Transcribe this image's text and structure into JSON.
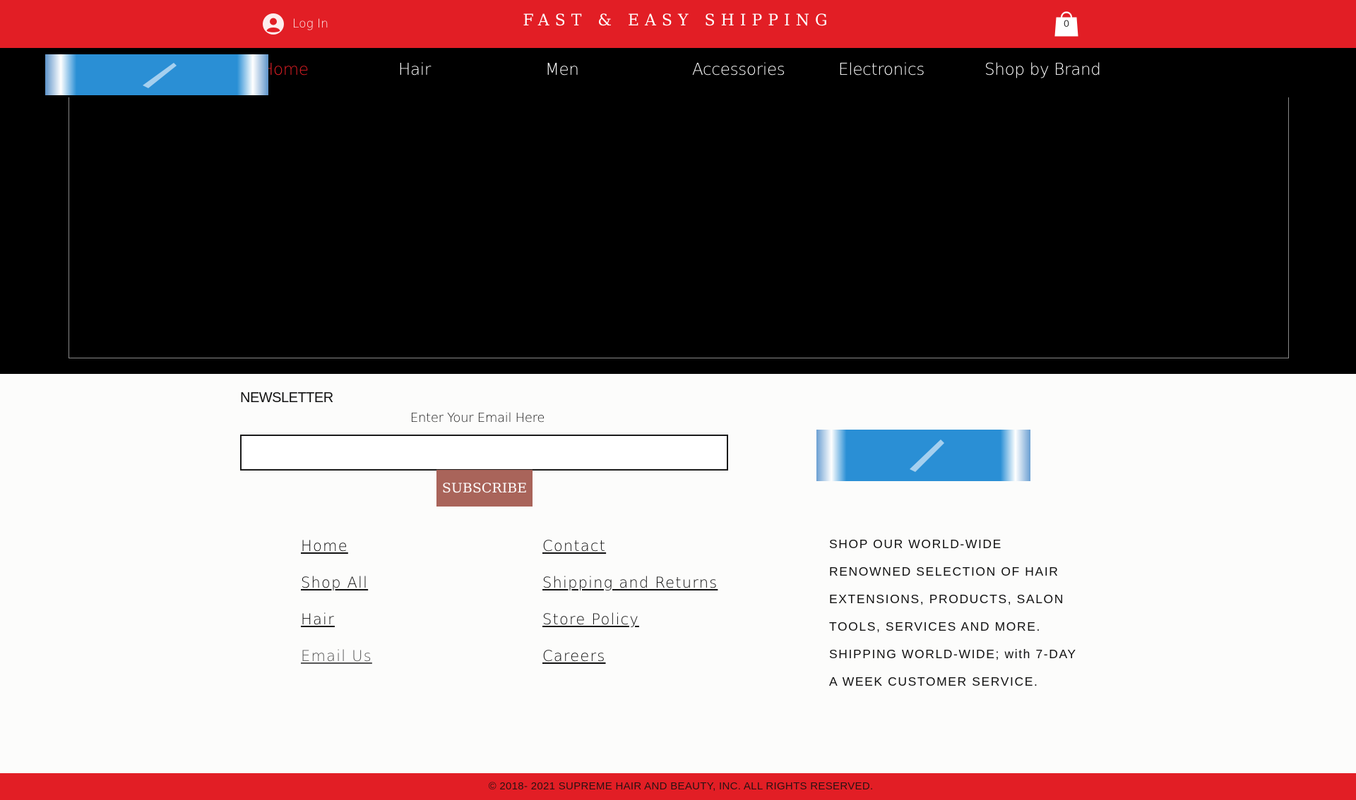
{
  "topbar": {
    "login_label": "Log In",
    "shipping_text": "FAST & EASY SHIPPING",
    "cart_count": "0",
    "background_color": "#e21e25"
  },
  "nav": {
    "items": [
      {
        "label": "Home",
        "active": true
      },
      {
        "label": "Hair"
      },
      {
        "label": "Men"
      },
      {
        "label": "Accessories"
      },
      {
        "label": "Electronics"
      },
      {
        "label": "Shop by Brand"
      }
    ],
    "active_color": "#e21e25"
  },
  "newsletter": {
    "title": "NEWSLETTER",
    "email_label": "Enter Your Email Here",
    "email_value": "",
    "subscribe_label": "SUBSCRIBE",
    "button_color": "#a9645a"
  },
  "footer_links": {
    "col1": [
      "Home",
      "Shop All",
      "Hair",
      "Email Us"
    ],
    "col2": [
      "Contact",
      "Shipping and Returns",
      "Store Policy",
      "Careers"
    ]
  },
  "about_text": [
    "SHOP OUR WORLD-WIDE",
    "RENOWNED SELECTION OF HAIR",
    "EXTENSIONS, PRODUCTS, SALON",
    "TOOLS, SERVICES AND MORE.",
    "SHIPPING WORLD-WIDE; with 7-DAY",
    "A WEEK CUSTOMER SERVICE."
  ],
  "copyright": "© 2018- 2021 SUPREME HAIR AND BEAUTY, INC. ALL RIGHTS RESERVED.",
  "icons": {
    "login": "user-avatar-icon",
    "cart": "shopping-bag-icon"
  }
}
